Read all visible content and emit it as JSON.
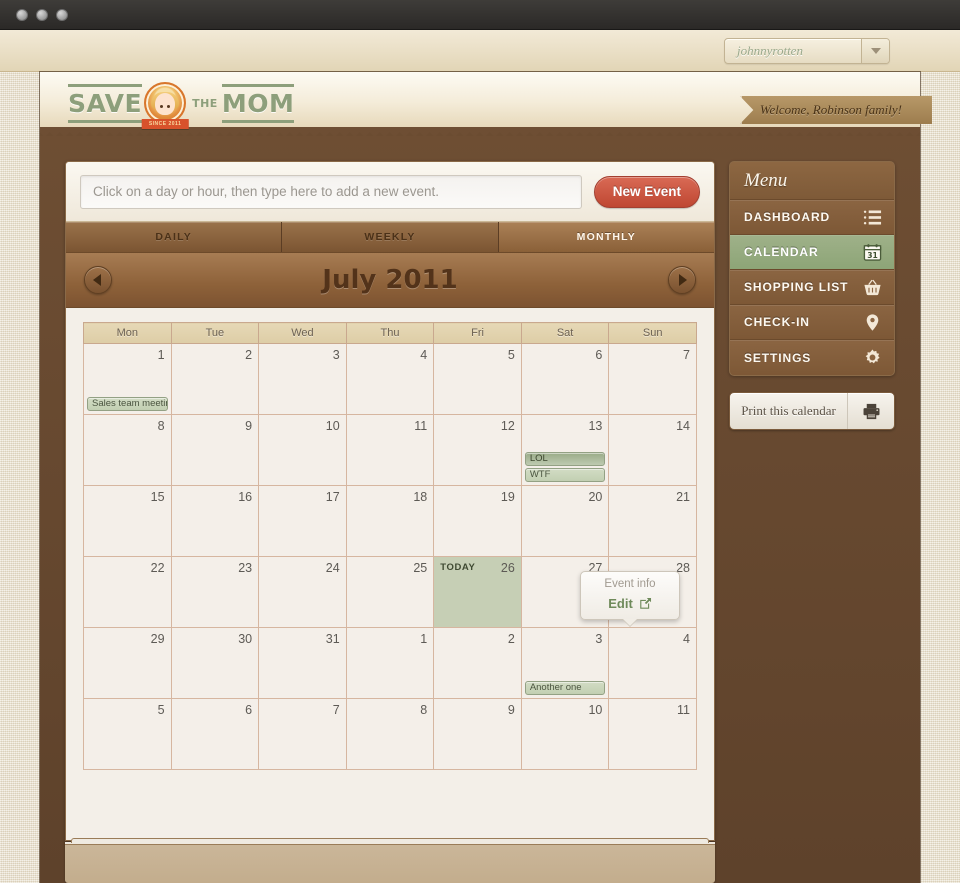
{
  "window": {
    "traffic_lights": [
      "close",
      "minimize",
      "zoom"
    ]
  },
  "browser": {
    "user_name": "johnnyrotten"
  },
  "brand": {
    "word1": "SAVE",
    "the": "THE",
    "word2": "MOM",
    "ribbon": "SINCE 2011"
  },
  "header": {
    "welcome": "Welcome, Robinson family!"
  },
  "event_entry": {
    "placeholder": "Click on a day or hour, then type here to add a new event.",
    "value": "",
    "new_event_label": "New Event"
  },
  "view_tabs": [
    {
      "label": "DAILY",
      "active": false
    },
    {
      "label": "WEEKLY",
      "active": false
    },
    {
      "label": "MONTHLY",
      "active": true
    }
  ],
  "month_nav": {
    "prev": "prev-month",
    "title": "July 2011",
    "next": "next-month"
  },
  "calendar": {
    "day_headers": [
      "Mon",
      "Tue",
      "Wed",
      "Thu",
      "Fri",
      "Sat",
      "Sun"
    ],
    "today_label": "TODAY",
    "weeks": [
      [
        {
          "num": "1",
          "events": [
            "Sales team meeting"
          ]
        },
        {
          "num": "2",
          "events": []
        },
        {
          "num": "3",
          "events": []
        },
        {
          "num": "4",
          "events": []
        },
        {
          "num": "5",
          "events": []
        },
        {
          "num": "6",
          "events": []
        },
        {
          "num": "7",
          "events": []
        }
      ],
      [
        {
          "num": "8",
          "events": []
        },
        {
          "num": "9",
          "events": []
        },
        {
          "num": "10",
          "events": []
        },
        {
          "num": "11",
          "events": []
        },
        {
          "num": "12",
          "events": []
        },
        {
          "num": "13",
          "events": [
            "LOL",
            "WTF"
          ]
        },
        {
          "num": "14",
          "events": []
        }
      ],
      [
        {
          "num": "15",
          "events": []
        },
        {
          "num": "16",
          "events": []
        },
        {
          "num": "17",
          "events": []
        },
        {
          "num": "18",
          "events": []
        },
        {
          "num": "19",
          "events": []
        },
        {
          "num": "20",
          "events": []
        },
        {
          "num": "21",
          "events": []
        }
      ],
      [
        {
          "num": "22",
          "events": []
        },
        {
          "num": "23",
          "events": []
        },
        {
          "num": "24",
          "events": []
        },
        {
          "num": "25",
          "events": []
        },
        {
          "num": "26",
          "events": [],
          "today": true
        },
        {
          "num": "27",
          "events": []
        },
        {
          "num": "28",
          "events": []
        }
      ],
      [
        {
          "num": "29",
          "events": []
        },
        {
          "num": "30",
          "events": []
        },
        {
          "num": "31",
          "events": []
        },
        {
          "num": "1",
          "events": []
        },
        {
          "num": "2",
          "events": []
        },
        {
          "num": "3",
          "events": [
            "Another one"
          ]
        },
        {
          "num": "4",
          "events": []
        }
      ],
      [
        {
          "num": "5",
          "events": []
        },
        {
          "num": "6",
          "events": []
        },
        {
          "num": "7",
          "events": []
        },
        {
          "num": "8",
          "events": []
        },
        {
          "num": "9",
          "events": []
        },
        {
          "num": "10",
          "events": []
        },
        {
          "num": "11",
          "events": []
        }
      ]
    ]
  },
  "popover": {
    "title": "Event info",
    "edit_label": "Edit",
    "edit_icon": "edit-square-icon"
  },
  "sidebar": {
    "heading": "Menu",
    "items": [
      {
        "label": "DASHBOARD",
        "icon": "list-icon",
        "active": false
      },
      {
        "label": "CALENDAR",
        "icon": "calendar-31-icon",
        "active": true
      },
      {
        "label": "SHOPPING LIST",
        "icon": "basket-icon",
        "active": false
      },
      {
        "label": "CHECK-IN",
        "icon": "map-pin-icon",
        "active": false
      },
      {
        "label": "SETTINGS",
        "icon": "gear-icon",
        "active": false
      }
    ],
    "print": {
      "label": "Print this calendar",
      "icon": "printer-icon"
    }
  },
  "colors": {
    "accent_red": "#c24c35",
    "brand_green": "#8d9f7b",
    "today_green": "#c6cfb5",
    "app_brown": "#6d4e33",
    "menu_brown": "#8b6542",
    "active_menu_green": "#97a980"
  }
}
